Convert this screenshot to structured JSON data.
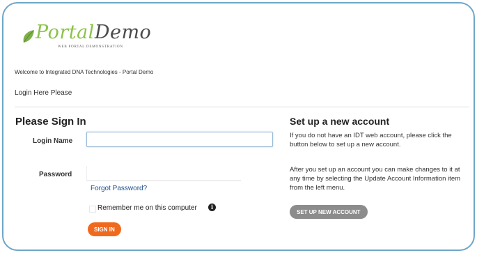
{
  "brand": {
    "name_part1": "Portal",
    "name_part2": "Demo",
    "tagline": "WEB PORTAL DEMONSTRATION",
    "accent_color": "#8bc24a"
  },
  "header": {
    "welcome": "Welcome to Integrated DNA Technologies - Portal Demo",
    "subtitle": "Login Here Please"
  },
  "signin": {
    "title": "Please Sign In",
    "login_label": "Login Name",
    "login_value": "",
    "password_label": "Password",
    "password_value": "",
    "forgot_link": "Forgot Password?",
    "remember_label": "Remember me on this computer",
    "remember_checked": false,
    "info_icon": "info-icon",
    "submit_label": "SIGN IN",
    "submit_color": "#f06a1e"
  },
  "new_account": {
    "title": "Set up a new account",
    "para1": "If you do not have an IDT web account, please click the button below to set up a new account.",
    "para2": "After you set up an account you can make changes to it at any time by selecting the Update Account Information item from the left menu.",
    "button_label": "SET UP NEW ACCOUNT",
    "button_color": "#8c8c8c"
  }
}
